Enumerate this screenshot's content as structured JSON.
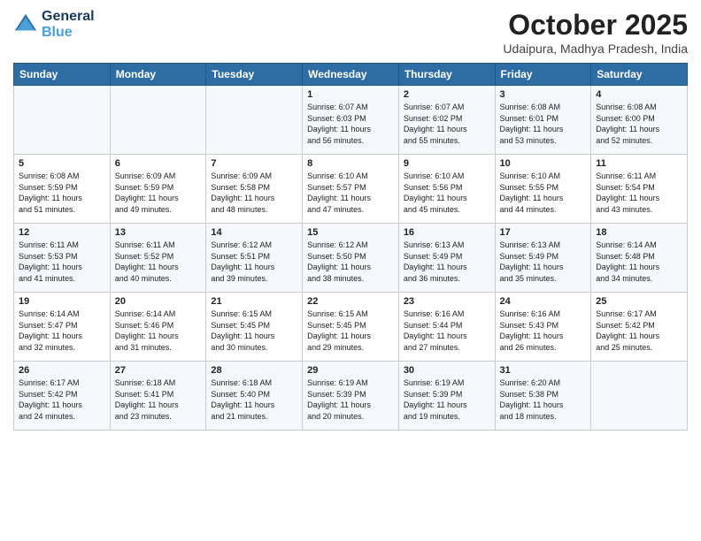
{
  "logo": {
    "line1": "General",
    "line2": "Blue"
  },
  "title": "October 2025",
  "location": "Udaipura, Madhya Pradesh, India",
  "days_of_week": [
    "Sunday",
    "Monday",
    "Tuesday",
    "Wednesday",
    "Thursday",
    "Friday",
    "Saturday"
  ],
  "weeks": [
    [
      {
        "day": "",
        "text": ""
      },
      {
        "day": "",
        "text": ""
      },
      {
        "day": "",
        "text": ""
      },
      {
        "day": "1",
        "text": "Sunrise: 6:07 AM\nSunset: 6:03 PM\nDaylight: 11 hours\nand 56 minutes."
      },
      {
        "day": "2",
        "text": "Sunrise: 6:07 AM\nSunset: 6:02 PM\nDaylight: 11 hours\nand 55 minutes."
      },
      {
        "day": "3",
        "text": "Sunrise: 6:08 AM\nSunset: 6:01 PM\nDaylight: 11 hours\nand 53 minutes."
      },
      {
        "day": "4",
        "text": "Sunrise: 6:08 AM\nSunset: 6:00 PM\nDaylight: 11 hours\nand 52 minutes."
      }
    ],
    [
      {
        "day": "5",
        "text": "Sunrise: 6:08 AM\nSunset: 5:59 PM\nDaylight: 11 hours\nand 51 minutes."
      },
      {
        "day": "6",
        "text": "Sunrise: 6:09 AM\nSunset: 5:59 PM\nDaylight: 11 hours\nand 49 minutes."
      },
      {
        "day": "7",
        "text": "Sunrise: 6:09 AM\nSunset: 5:58 PM\nDaylight: 11 hours\nand 48 minutes."
      },
      {
        "day": "8",
        "text": "Sunrise: 6:10 AM\nSunset: 5:57 PM\nDaylight: 11 hours\nand 47 minutes."
      },
      {
        "day": "9",
        "text": "Sunrise: 6:10 AM\nSunset: 5:56 PM\nDaylight: 11 hours\nand 45 minutes."
      },
      {
        "day": "10",
        "text": "Sunrise: 6:10 AM\nSunset: 5:55 PM\nDaylight: 11 hours\nand 44 minutes."
      },
      {
        "day": "11",
        "text": "Sunrise: 6:11 AM\nSunset: 5:54 PM\nDaylight: 11 hours\nand 43 minutes."
      }
    ],
    [
      {
        "day": "12",
        "text": "Sunrise: 6:11 AM\nSunset: 5:53 PM\nDaylight: 11 hours\nand 41 minutes."
      },
      {
        "day": "13",
        "text": "Sunrise: 6:11 AM\nSunset: 5:52 PM\nDaylight: 11 hours\nand 40 minutes."
      },
      {
        "day": "14",
        "text": "Sunrise: 6:12 AM\nSunset: 5:51 PM\nDaylight: 11 hours\nand 39 minutes."
      },
      {
        "day": "15",
        "text": "Sunrise: 6:12 AM\nSunset: 5:50 PM\nDaylight: 11 hours\nand 38 minutes."
      },
      {
        "day": "16",
        "text": "Sunrise: 6:13 AM\nSunset: 5:49 PM\nDaylight: 11 hours\nand 36 minutes."
      },
      {
        "day": "17",
        "text": "Sunrise: 6:13 AM\nSunset: 5:49 PM\nDaylight: 11 hours\nand 35 minutes."
      },
      {
        "day": "18",
        "text": "Sunrise: 6:14 AM\nSunset: 5:48 PM\nDaylight: 11 hours\nand 34 minutes."
      }
    ],
    [
      {
        "day": "19",
        "text": "Sunrise: 6:14 AM\nSunset: 5:47 PM\nDaylight: 11 hours\nand 32 minutes."
      },
      {
        "day": "20",
        "text": "Sunrise: 6:14 AM\nSunset: 5:46 PM\nDaylight: 11 hours\nand 31 minutes."
      },
      {
        "day": "21",
        "text": "Sunrise: 6:15 AM\nSunset: 5:45 PM\nDaylight: 11 hours\nand 30 minutes."
      },
      {
        "day": "22",
        "text": "Sunrise: 6:15 AM\nSunset: 5:45 PM\nDaylight: 11 hours\nand 29 minutes."
      },
      {
        "day": "23",
        "text": "Sunrise: 6:16 AM\nSunset: 5:44 PM\nDaylight: 11 hours\nand 27 minutes."
      },
      {
        "day": "24",
        "text": "Sunrise: 6:16 AM\nSunset: 5:43 PM\nDaylight: 11 hours\nand 26 minutes."
      },
      {
        "day": "25",
        "text": "Sunrise: 6:17 AM\nSunset: 5:42 PM\nDaylight: 11 hours\nand 25 minutes."
      }
    ],
    [
      {
        "day": "26",
        "text": "Sunrise: 6:17 AM\nSunset: 5:42 PM\nDaylight: 11 hours\nand 24 minutes."
      },
      {
        "day": "27",
        "text": "Sunrise: 6:18 AM\nSunset: 5:41 PM\nDaylight: 11 hours\nand 23 minutes."
      },
      {
        "day": "28",
        "text": "Sunrise: 6:18 AM\nSunset: 5:40 PM\nDaylight: 11 hours\nand 21 minutes."
      },
      {
        "day": "29",
        "text": "Sunrise: 6:19 AM\nSunset: 5:39 PM\nDaylight: 11 hours\nand 20 minutes."
      },
      {
        "day": "30",
        "text": "Sunrise: 6:19 AM\nSunset: 5:39 PM\nDaylight: 11 hours\nand 19 minutes."
      },
      {
        "day": "31",
        "text": "Sunrise: 6:20 AM\nSunset: 5:38 PM\nDaylight: 11 hours\nand 18 minutes."
      },
      {
        "day": "",
        "text": ""
      }
    ]
  ]
}
